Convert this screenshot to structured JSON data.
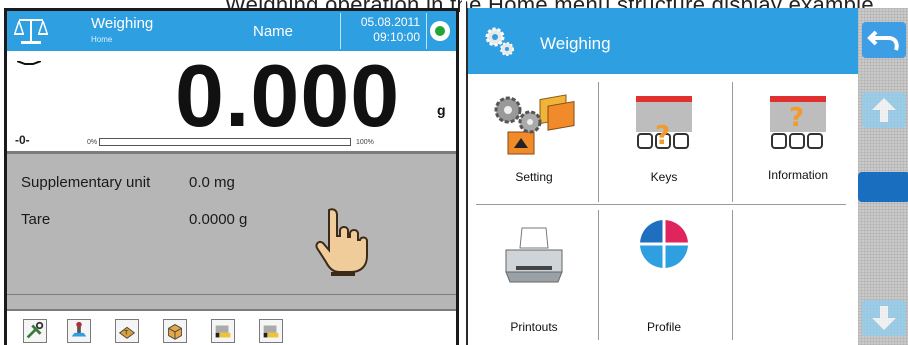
{
  "top_text": "Weighing operation in the Home menu structure display example",
  "left_panel": {
    "header": {
      "title": "Weighing",
      "subtitle": "Home",
      "name_label": "Name",
      "date": "05.08.2011",
      "time": "09:10:00"
    },
    "display": {
      "value": "0.000",
      "unit": "g",
      "zero_indicator": "-0-",
      "bar_min_label": "0%",
      "bar_max_label": "100%",
      "bar_level": 0
    },
    "info": [
      {
        "label": "Supplementary unit",
        "value": "0.0 mg"
      },
      {
        "label": "Tare",
        "value": "0.0000 g"
      }
    ],
    "toolbar": {
      "icons": [
        "tools-icon",
        "weighing-pan-icon",
        "tare-box-icon",
        "product-box-icon",
        "printer-bar-icon",
        "printer-bar-alt-icon"
      ]
    }
  },
  "right_panel": {
    "header": {
      "title": "Weighing"
    },
    "menu_items": [
      {
        "label": "Setting",
        "icon": "settings-gears-icon"
      },
      {
        "label": "Keys",
        "icon": "keys-question-icon"
      },
      {
        "label": "Information",
        "icon": "information-question-icon"
      },
      {
        "label": "Printouts",
        "icon": "printer-icon"
      },
      {
        "label": "Profile",
        "icon": "profile-pie-icon"
      }
    ],
    "side": {
      "back_icon": "back-arrow-icon",
      "up_icon": "up-arrow-icon",
      "down_icon": "down-arrow-icon"
    }
  },
  "colors": {
    "header_blue": "#2e9fe0",
    "info_grey": "#b6b6b6",
    "status_green": "#22a535"
  }
}
